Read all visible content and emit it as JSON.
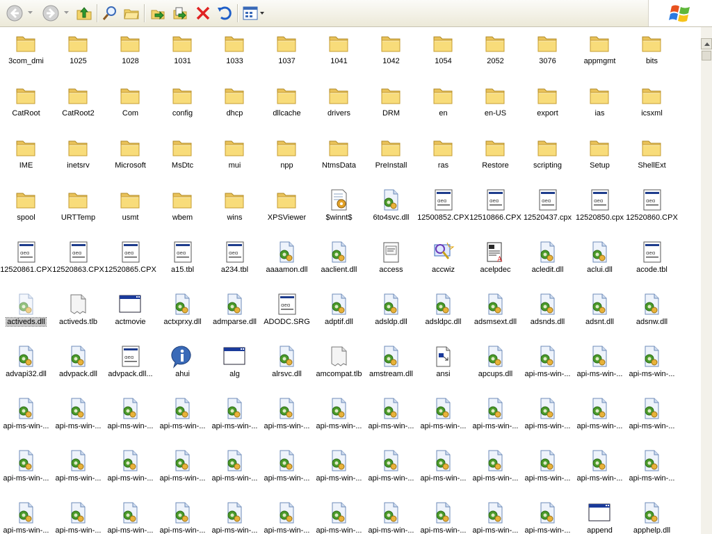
{
  "toolbar": {
    "buttons": [
      {
        "name": "back-button",
        "icon": "back-arrow-icon"
      },
      {
        "name": "back-dropdown",
        "icon": "chevron-down-icon"
      },
      {
        "name": "forward-button",
        "icon": "forward-arrow-icon"
      },
      {
        "name": "forward-dropdown",
        "icon": "chevron-down-icon"
      },
      {
        "name": "up-button",
        "icon": "folder-up-icon"
      },
      {
        "name": "search-button",
        "icon": "search-icon"
      },
      {
        "name": "folders-button",
        "icon": "folders-icon"
      },
      {
        "name": "move-to-button",
        "icon": "move-to-icon"
      },
      {
        "name": "copy-to-button",
        "icon": "copy-to-icon"
      },
      {
        "name": "delete-button",
        "icon": "delete-icon"
      },
      {
        "name": "undo-button",
        "icon": "undo-icon"
      },
      {
        "name": "views-button",
        "icon": "views-icon"
      }
    ],
    "colors": {
      "back": "#9a9a9a",
      "delete": "#e02222",
      "undo": "#1f5fc8",
      "folder": "#f3d46a"
    }
  },
  "items": [
    {
      "label": "3com_dmi",
      "type": "folder"
    },
    {
      "label": "1025",
      "type": "folder"
    },
    {
      "label": "1028",
      "type": "folder"
    },
    {
      "label": "1031",
      "type": "folder"
    },
    {
      "label": "1033",
      "type": "folder"
    },
    {
      "label": "1037",
      "type": "folder"
    },
    {
      "label": "1041",
      "type": "folder"
    },
    {
      "label": "1042",
      "type": "folder"
    },
    {
      "label": "1054",
      "type": "folder"
    },
    {
      "label": "2052",
      "type": "folder"
    },
    {
      "label": "3076",
      "type": "folder"
    },
    {
      "label": "appmgmt",
      "type": "folder"
    },
    {
      "label": "bits",
      "type": "folder"
    },
    {
      "label": "CatRoot",
      "type": "folder"
    },
    {
      "label": "CatRoot2",
      "type": "folder"
    },
    {
      "label": "Com",
      "type": "folder"
    },
    {
      "label": "config",
      "type": "folder"
    },
    {
      "label": "dhcp",
      "type": "folder"
    },
    {
      "label": "dllcache",
      "type": "folder"
    },
    {
      "label": "drivers",
      "type": "folder"
    },
    {
      "label": "DRM",
      "type": "folder"
    },
    {
      "label": "en",
      "type": "folder"
    },
    {
      "label": "en-US",
      "type": "folder"
    },
    {
      "label": "export",
      "type": "folder"
    },
    {
      "label": "ias",
      "type": "folder"
    },
    {
      "label": "icsxml",
      "type": "folder"
    },
    {
      "label": "IME",
      "type": "folder"
    },
    {
      "label": "inetsrv",
      "type": "folder"
    },
    {
      "label": "Microsoft",
      "type": "folder"
    },
    {
      "label": "MsDtc",
      "type": "folder"
    },
    {
      "label": "mui",
      "type": "folder"
    },
    {
      "label": "npp",
      "type": "folder"
    },
    {
      "label": "NtmsData",
      "type": "folder"
    },
    {
      "label": "PreInstall",
      "type": "folder"
    },
    {
      "label": "ras",
      "type": "folder"
    },
    {
      "label": "Restore",
      "type": "folder"
    },
    {
      "label": "scripting",
      "type": "folder"
    },
    {
      "label": "Setup",
      "type": "folder"
    },
    {
      "label": "ShellExt",
      "type": "folder"
    },
    {
      "label": "spool",
      "type": "folder"
    },
    {
      "label": "URTTemp",
      "type": "folder"
    },
    {
      "label": "usmt",
      "type": "folder"
    },
    {
      "label": "wbem",
      "type": "folder"
    },
    {
      "label": "wins",
      "type": "folder"
    },
    {
      "label": "XPSViewer",
      "type": "folder"
    },
    {
      "label": "$winnt$",
      "type": "ini"
    },
    {
      "label": "6to4svc.dll",
      "type": "dll"
    },
    {
      "label": "12500852.CPX",
      "type": "cpx"
    },
    {
      "label": "12510866.CPX",
      "type": "cpx"
    },
    {
      "label": "12520437.cpx",
      "type": "cpx"
    },
    {
      "label": "12520850.cpx",
      "type": "cpx"
    },
    {
      "label": "12520860.CPX",
      "type": "cpx"
    },
    {
      "label": "12520861.CPX",
      "type": "cpx"
    },
    {
      "label": "12520863.CPX",
      "type": "cpx"
    },
    {
      "label": "12520865.CPX",
      "type": "cpx"
    },
    {
      "label": "a15.tbl",
      "type": "cpx"
    },
    {
      "label": "a234.tbl",
      "type": "cpx"
    },
    {
      "label": "aaaamon.dll",
      "type": "dll"
    },
    {
      "label": "aaclient.dll",
      "type": "dll"
    },
    {
      "label": "access",
      "type": "cpl"
    },
    {
      "label": "accwiz",
      "type": "wizard"
    },
    {
      "label": "acelpdec",
      "type": "codec"
    },
    {
      "label": "acledit.dll",
      "type": "dll"
    },
    {
      "label": "aclui.dll",
      "type": "dll"
    },
    {
      "label": "acode.tbl",
      "type": "cpx"
    },
    {
      "label": "activeds.dll",
      "type": "dll",
      "selected": true
    },
    {
      "label": "activeds.tlb",
      "type": "generic"
    },
    {
      "label": "actmovie",
      "type": "exe"
    },
    {
      "label": "actxprxy.dll",
      "type": "dll"
    },
    {
      "label": "admparse.dll",
      "type": "dll"
    },
    {
      "label": "ADODC.SRG",
      "type": "cpx"
    },
    {
      "label": "adptif.dll",
      "type": "dll"
    },
    {
      "label": "adsldp.dll",
      "type": "dll"
    },
    {
      "label": "adsldpc.dll",
      "type": "dll"
    },
    {
      "label": "adsmsext.dll",
      "type": "dll"
    },
    {
      "label": "adsnds.dll",
      "type": "dll"
    },
    {
      "label": "adsnt.dll",
      "type": "dll"
    },
    {
      "label": "adsnw.dll",
      "type": "dll"
    },
    {
      "label": "advapi32.dll",
      "type": "dll"
    },
    {
      "label": "advpack.dll",
      "type": "dll"
    },
    {
      "label": "advpack.dll...",
      "type": "cpx"
    },
    {
      "label": "ahui",
      "type": "info"
    },
    {
      "label": "alg",
      "type": "exe"
    },
    {
      "label": "alrsvc.dll",
      "type": "dll"
    },
    {
      "label": "amcompat.tlb",
      "type": "generic"
    },
    {
      "label": "amstream.dll",
      "type": "dll"
    },
    {
      "label": "ansi",
      "type": "sys"
    },
    {
      "label": "apcups.dll",
      "type": "dll"
    },
    {
      "label": "api-ms-win-...",
      "type": "dll"
    },
    {
      "label": "api-ms-win-...",
      "type": "dll"
    },
    {
      "label": "api-ms-win-...",
      "type": "dll"
    },
    {
      "label": "api-ms-win-...",
      "type": "dll"
    },
    {
      "label": "api-ms-win-...",
      "type": "dll"
    },
    {
      "label": "api-ms-win-...",
      "type": "dll"
    },
    {
      "label": "api-ms-win-...",
      "type": "dll"
    },
    {
      "label": "api-ms-win-...",
      "type": "dll"
    },
    {
      "label": "api-ms-win-...",
      "type": "dll"
    },
    {
      "label": "api-ms-win-...",
      "type": "dll"
    },
    {
      "label": "api-ms-win-...",
      "type": "dll"
    },
    {
      "label": "api-ms-win-...",
      "type": "dll"
    },
    {
      "label": "api-ms-win-...",
      "type": "dll"
    },
    {
      "label": "api-ms-win-...",
      "type": "dll"
    },
    {
      "label": "api-ms-win-...",
      "type": "dll"
    },
    {
      "label": "api-ms-win-...",
      "type": "dll"
    },
    {
      "label": "api-ms-win-...",
      "type": "dll"
    },
    {
      "label": "api-ms-win-...",
      "type": "dll"
    },
    {
      "label": "api-ms-win-...",
      "type": "dll"
    },
    {
      "label": "api-ms-win-...",
      "type": "dll"
    },
    {
      "label": "api-ms-win-...",
      "type": "dll"
    },
    {
      "label": "api-ms-win-...",
      "type": "dll"
    },
    {
      "label": "api-ms-win-...",
      "type": "dll"
    },
    {
      "label": "api-ms-win-...",
      "type": "dll"
    },
    {
      "label": "api-ms-win-...",
      "type": "dll"
    },
    {
      "label": "api-ms-win-...",
      "type": "dll"
    },
    {
      "label": "api-ms-win-...",
      "type": "dll"
    },
    {
      "label": "api-ms-win-...",
      "type": "dll"
    },
    {
      "label": "api-ms-win-...",
      "type": "dll"
    },
    {
      "label": "api-ms-win-...",
      "type": "dll"
    },
    {
      "label": "api-ms-win-...",
      "type": "dll"
    },
    {
      "label": "api-ms-win-...",
      "type": "dll"
    },
    {
      "label": "api-ms-win-...",
      "type": "dll"
    },
    {
      "label": "api-ms-win-...",
      "type": "dll"
    },
    {
      "label": "api-ms-win-...",
      "type": "dll"
    },
    {
      "label": "api-ms-win-...",
      "type": "dll"
    },
    {
      "label": "api-ms-win-...",
      "type": "dll"
    },
    {
      "label": "api-ms-win-...",
      "type": "dll"
    },
    {
      "label": "api-ms-win-...",
      "type": "dll"
    },
    {
      "label": "api-ms-win-...",
      "type": "dll"
    },
    {
      "label": "append",
      "type": "exe"
    },
    {
      "label": "apphelp.dll",
      "type": "dll"
    }
  ]
}
